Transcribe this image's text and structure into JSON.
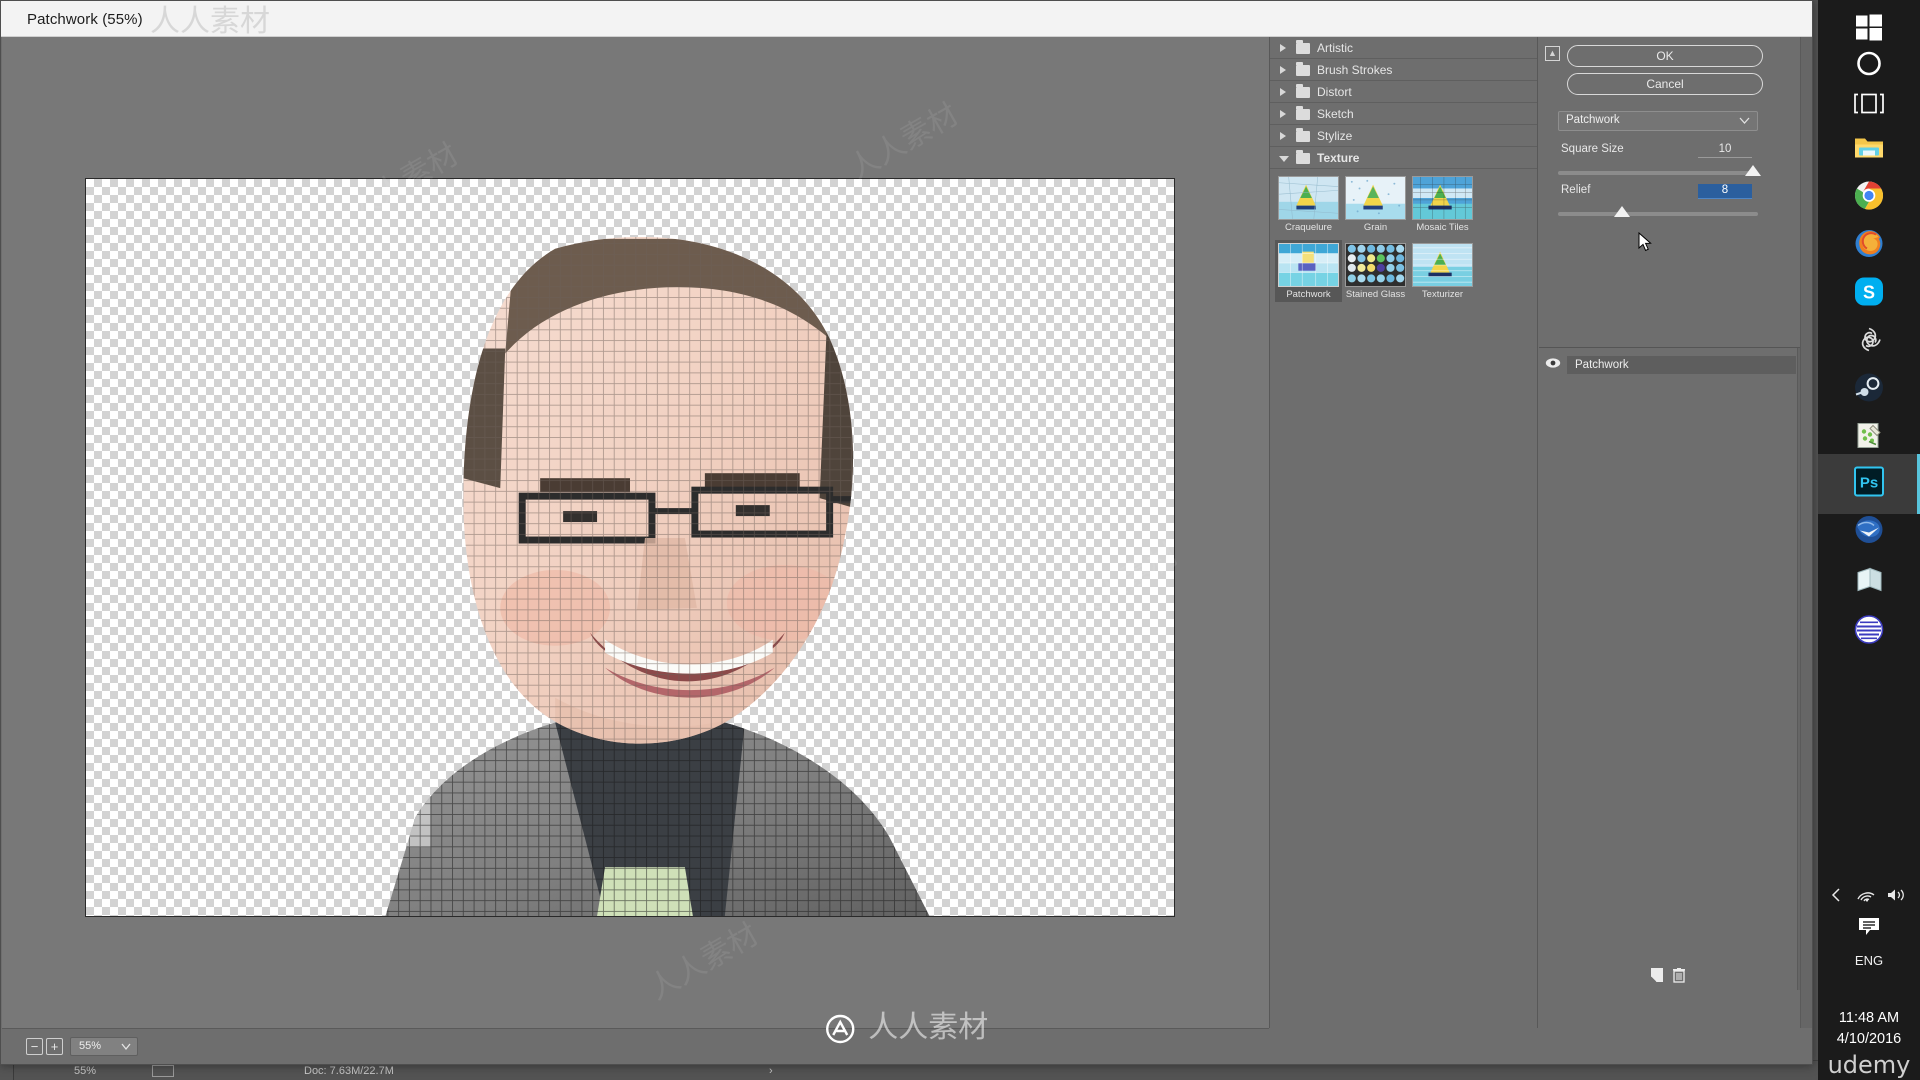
{
  "dialog": {
    "title": "Patchwork (55%)",
    "buttons": {
      "ok": "OK",
      "cancel": "Cancel"
    },
    "collapse_icon": "collapse-panel-icon"
  },
  "preview": {
    "zoom_out_label": "−",
    "zoom_in_label": "+",
    "zoom_value": "55%",
    "zoom_chevron": "chevron-down-icon",
    "image_alt": "patchwork-filtered-portrait"
  },
  "filter_tree": {
    "categories": [
      {
        "label": "Artistic",
        "expanded": false
      },
      {
        "label": "Brush Strokes",
        "expanded": false
      },
      {
        "label": "Distort",
        "expanded": false
      },
      {
        "label": "Sketch",
        "expanded": false
      },
      {
        "label": "Stylize",
        "expanded": false
      },
      {
        "label": "Texture",
        "expanded": true
      }
    ],
    "texture_filters": [
      {
        "label": "Craquelure",
        "selected": false
      },
      {
        "label": "Grain",
        "selected": false
      },
      {
        "label": "Mosaic Tiles",
        "selected": false
      },
      {
        "label": "Patchwork",
        "selected": true
      },
      {
        "label": "Stained Glass",
        "selected": false
      },
      {
        "label": "Texturizer",
        "selected": false
      }
    ]
  },
  "settings": {
    "selected_filter": "Patchwork",
    "dropdown_icon": "chevron-down-icon",
    "params": [
      {
        "name": "Square Size",
        "accesskey": "S",
        "value": "10",
        "min": 0,
        "max": 10,
        "active": false
      },
      {
        "name": "Relief",
        "accesskey": "R",
        "value": "8",
        "min": 0,
        "max": 25,
        "active": true
      }
    ]
  },
  "effects_layers": {
    "rows": [
      {
        "name": "Patchwork",
        "visible": true,
        "eye_icon": "eye-icon"
      }
    ],
    "new_effect_icon": "new-effect-layer-icon",
    "delete_icon": "trash-icon"
  },
  "photoshop_status": {
    "zoom": "55%",
    "doc": "Doc: 7.63M/22.7M"
  },
  "taskbar": {
    "items": [
      {
        "name": "start",
        "icon": "windows-logo-icon",
        "active": false
      },
      {
        "name": "cortana",
        "icon": "cortana-circle-icon",
        "active": false
      },
      {
        "name": "task-view",
        "icon": "task-view-icon",
        "active": false
      },
      {
        "name": "file-explorer",
        "icon": "folder-icon",
        "active": false
      },
      {
        "name": "chrome",
        "icon": "chrome-icon",
        "active": false
      },
      {
        "name": "firefox",
        "icon": "firefox-icon",
        "active": false
      },
      {
        "name": "skype",
        "icon": "skype-icon",
        "active": false
      },
      {
        "name": "swirl-app",
        "icon": "swirl-icon",
        "active": false
      },
      {
        "name": "steam",
        "icon": "steam-icon",
        "active": false
      },
      {
        "name": "notes-app",
        "icon": "notes-icon",
        "active": false
      },
      {
        "name": "photoshop",
        "icon": "photoshop-ps-icon",
        "active": true
      },
      {
        "name": "thunderbird",
        "icon": "thunderbird-icon",
        "active": false
      },
      {
        "name": "notepad",
        "icon": "notepad-icon",
        "active": false
      },
      {
        "name": "globe-app",
        "icon": "globe-icon",
        "active": false
      }
    ],
    "tray": {
      "expand_icon": "chevron-left-icon",
      "network_icon": "wifi-icon",
      "volume_icon": "speaker-icon",
      "action_center_icon": "action-center-icon",
      "language": "ENG",
      "time": "11:48 AM",
      "date": "4/10/2016",
      "watermark": "udemy"
    }
  },
  "watermark": {
    "brand": "人人素材",
    "tiles": [
      "人人素材",
      "人人素材",
      "人人素材",
      "人人素材",
      "人人素材",
      "人人素材",
      "人人素材",
      "人人素材",
      "人人素材",
      "人人素材",
      "人人素材",
      "人人素材"
    ]
  },
  "colors": {
    "dialog_bg": "#6e6e6e",
    "titlebar_bg": "#f3f3f3",
    "preview_bg": "#787878",
    "selection_blue": "#2b5f9e",
    "taskbar_bg": "#1b1b1b",
    "accent": "#58c4dc"
  }
}
